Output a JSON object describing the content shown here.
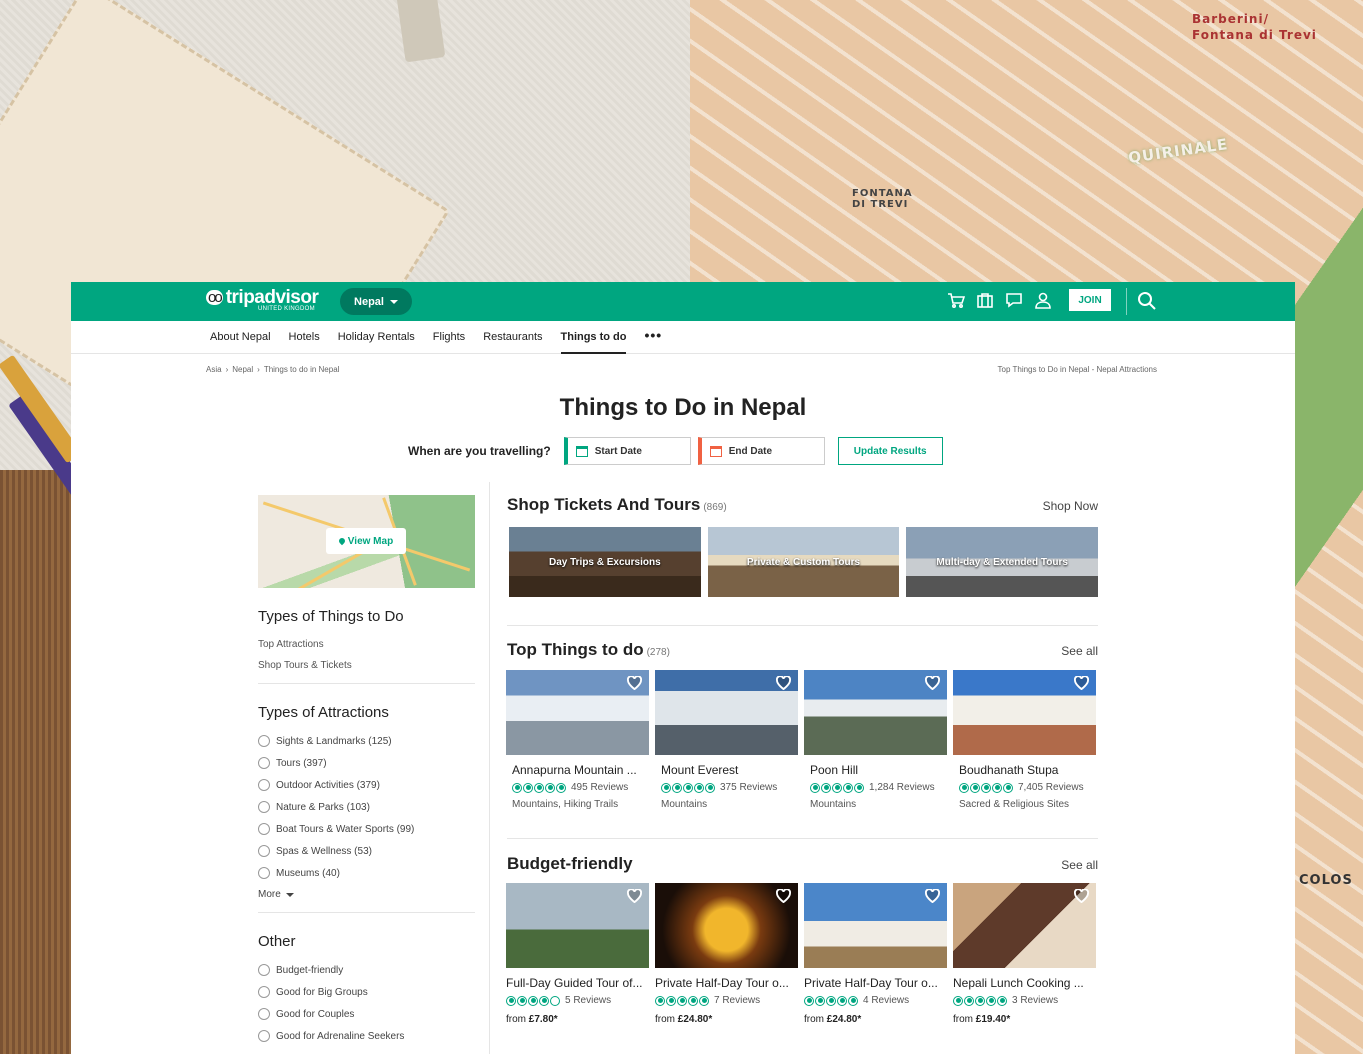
{
  "background": {
    "map_labels": [
      "Barberini/",
      "Fontana di Trevi",
      "QUIRINALE",
      "FONTANA DI TREVI",
      "COLOS"
    ]
  },
  "header": {
    "logo_text": "tripadvisor",
    "logo_sub": "UNITED KINGDOM",
    "geo": "Nepal",
    "join": "JOIN",
    "icons": [
      "cart-icon",
      "briefcase-icon",
      "chat-icon",
      "user-icon"
    ]
  },
  "subnav": {
    "items": [
      "About Nepal",
      "Hotels",
      "Holiday Rentals",
      "Flights",
      "Restaurants",
      "Things to do"
    ],
    "more": "•••"
  },
  "breadcrumbs": [
    "Asia",
    "Nepal",
    "Things to do in Nepal"
  ],
  "breadcrumb_sep": "›",
  "breadcrumb_right": "Top Things to Do in Nepal - Nepal Attractions",
  "title": "Things to Do in Nepal",
  "dates": {
    "question": "When are you travelling?",
    "start": "Start Date",
    "end": "End Date",
    "update": "Update Results"
  },
  "sidebar": {
    "view_map": "View Map",
    "types_heading": "Types of Things to Do",
    "types": [
      "Top Attractions",
      "Shop Tours & Tickets"
    ],
    "attractions_heading": "Types of Attractions",
    "attractions": [
      "Sights & Landmarks (125)",
      "Tours (397)",
      "Outdoor Activities (379)",
      "Nature & Parks (103)",
      "Boat Tours & Water Sports (99)",
      "Spas & Wellness (53)",
      "Museums (40)"
    ],
    "more": "More",
    "other_heading": "Other",
    "other": [
      "Budget-friendly",
      "Good for Big Groups",
      "Good for Couples",
      "Good for Adrenaline Seekers"
    ]
  },
  "shop": {
    "title": "Shop Tickets And Tours",
    "count": "(869)",
    "link": "Shop Now",
    "tiles": [
      "Day Trips & Excursions",
      "Private & Custom Tours",
      "Multi-day & Extended Tours"
    ]
  },
  "top": {
    "title": "Top Things to do",
    "count": "(278)",
    "link": "See all",
    "cards": [
      {
        "title": "Annapurna Mountain ...",
        "rating": 5,
        "reviews": "495 Reviews",
        "sub": "Mountains, Hiking Trails"
      },
      {
        "title": "Mount Everest",
        "rating": 5,
        "reviews": "375 Reviews",
        "sub": "Mountains"
      },
      {
        "title": "Poon Hill",
        "rating": 5,
        "reviews": "1,284 Reviews",
        "sub": "Mountains"
      },
      {
        "title": "Boudhanath Stupa",
        "rating": 5,
        "reviews": "7,405 Reviews",
        "sub": "Sacred & Religious Sites"
      }
    ]
  },
  "budget": {
    "title": "Budget-friendly",
    "link": "See all",
    "price_prefix": "from",
    "cards": [
      {
        "title": "Full-Day Guided Tour of...",
        "rating": 4,
        "reviews": "5 Reviews",
        "price": "£7.80*"
      },
      {
        "title": "Private Half-Day Tour o...",
        "rating": 5,
        "reviews": "7 Reviews",
        "price": "£24.80*"
      },
      {
        "title": "Private Half-Day Tour o...",
        "rating": 5,
        "reviews": "4 Reviews",
        "price": "£24.80*"
      },
      {
        "title": "Nepali Lunch Cooking ...",
        "rating": 5,
        "reviews": "3 Reviews",
        "price": "£19.40*"
      }
    ]
  },
  "colors": {
    "brand": "#00a680",
    "brand_dark": "#00795f",
    "end_date": "#f06142"
  }
}
